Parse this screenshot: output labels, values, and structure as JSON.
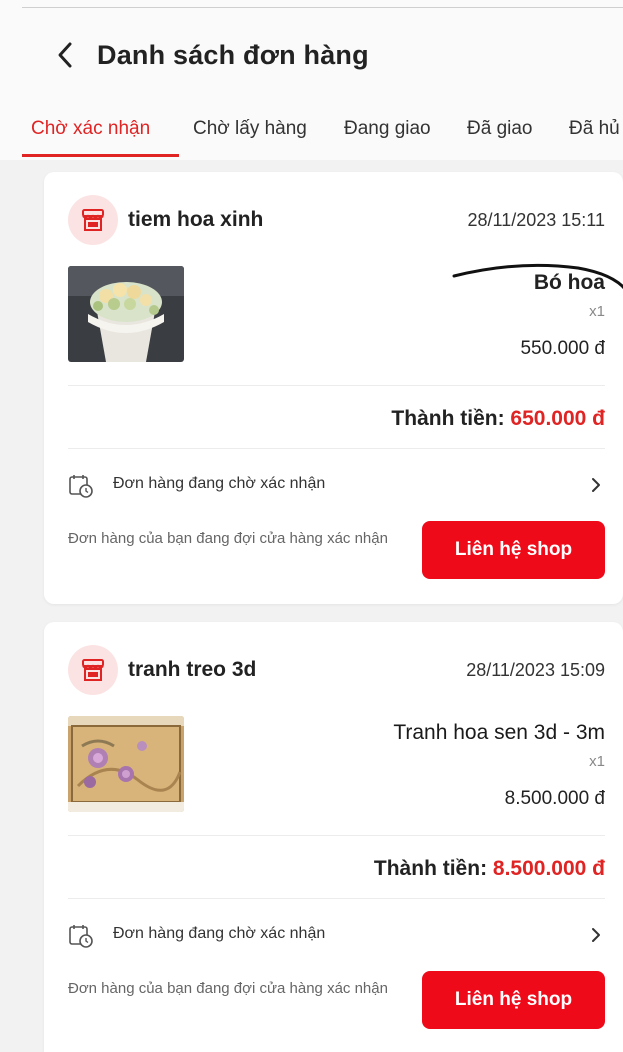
{
  "header": {
    "title": "Danh sách đơn hàng",
    "back_icon": "chevron-left-icon"
  },
  "tabs": [
    {
      "label": "Chờ xác nhận",
      "active": true
    },
    {
      "label": "Chờ lấy hàng",
      "active": false
    },
    {
      "label": "Đang giao",
      "active": false
    },
    {
      "label": "Đã giao",
      "active": false
    },
    {
      "label": "Đã hủ",
      "active": false
    }
  ],
  "colors": {
    "accent": "#e02424",
    "button": "#ee0a19",
    "shop_icon_bg": "#fbe3e3"
  },
  "orders": [
    {
      "shop_name": "tiem hoa xinh",
      "date": "28/11/2023 15:11",
      "shop_icon": "store-icon",
      "product_image": "flower-bouquet-image",
      "product_name": "Bó hoa",
      "quantity": "x1",
      "price": "550.000 đ",
      "total_label": "Thành tiền:",
      "total_amount": "650.000 đ",
      "status_icon": "calendar-clock-icon",
      "status_text": "Đơn hàng đang chờ xác nhận",
      "note": "Đơn hàng của bạn đang đợi cửa hàng xác nhận",
      "contact_label": "Liên hệ shop"
    },
    {
      "shop_name": "tranh treo 3d",
      "date": "28/11/2023 15:09",
      "shop_icon": "store-icon",
      "product_image": "lotus-painting-image",
      "product_name": "Tranh  hoa sen 3d - 3m",
      "quantity": "x1",
      "price": "8.500.000 đ",
      "total_label": "Thành tiền:",
      "total_amount": "8.500.000 đ",
      "status_icon": "calendar-clock-icon",
      "status_text": "Đơn hàng đang chờ xác nhận",
      "note": "Đơn hàng của bạn đang đợi cửa hàng xác nhận",
      "contact_label": "Liên hệ shop"
    }
  ]
}
